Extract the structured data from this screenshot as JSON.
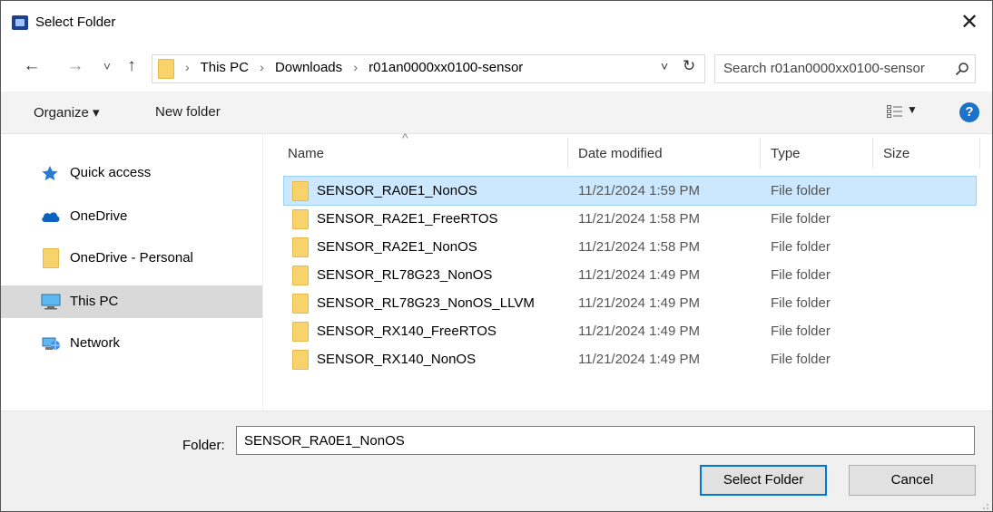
{
  "window": {
    "title": "Select Folder",
    "close_glyph": "✕"
  },
  "nav": {
    "back_glyph": "←",
    "forward_glyph": "→",
    "recent_glyph": "˅",
    "up_glyph": "↑",
    "breadcrumbs": [
      "This PC",
      "Downloads",
      "r01an0000xx0100-sensor"
    ],
    "separator": "›",
    "dropdown_glyph": "˅",
    "refresh_glyph": "↻",
    "search_placeholder": "Search r01an0000xx0100-sensor"
  },
  "toolbar": {
    "organize_label": "Organize ▾",
    "new_folder_label": "New folder",
    "view_dropdown_glyph": "▼",
    "help_glyph": "?"
  },
  "sidebar": {
    "items": [
      {
        "label": "Quick access",
        "icon": "star-icon"
      },
      {
        "label": "OneDrive",
        "icon": "cloud-icon"
      },
      {
        "label": "OneDrive - Personal",
        "icon": "folder-icon"
      },
      {
        "label": "This PC",
        "icon": "computer-icon",
        "selected": true
      },
      {
        "label": "Network",
        "icon": "network-icon"
      }
    ]
  },
  "columns": {
    "name": "Name",
    "date": "Date modified",
    "type": "Type",
    "size": "Size",
    "sort_glyph": "^"
  },
  "files": [
    {
      "name": "SENSOR_RA0E1_NonOS",
      "date": "11/21/2024 1:59 PM",
      "type": "File folder",
      "selected": true
    },
    {
      "name": "SENSOR_RA2E1_FreeRTOS",
      "date": "11/21/2024 1:58 PM",
      "type": "File folder"
    },
    {
      "name": "SENSOR_RA2E1_NonOS",
      "date": "11/21/2024 1:58 PM",
      "type": "File folder"
    },
    {
      "name": "SENSOR_RL78G23_NonOS",
      "date": "11/21/2024 1:49 PM",
      "type": "File folder"
    },
    {
      "name": "SENSOR_RL78G23_NonOS_LLVM",
      "date": "11/21/2024 1:49 PM",
      "type": "File folder"
    },
    {
      "name": "SENSOR_RX140_FreeRTOS",
      "date": "11/21/2024 1:49 PM",
      "type": "File folder"
    },
    {
      "name": "SENSOR_RX140_NonOS",
      "date": "11/21/2024 1:49 PM",
      "type": "File folder"
    }
  ],
  "footer": {
    "folder_label": "Folder:",
    "folder_value": "SENSOR_RA0E1_NonOS",
    "select_label": "Select Folder",
    "cancel_label": "Cancel"
  },
  "colors": {
    "selection_bg": "#cce8ff",
    "accent": "#0078d7",
    "folder": "#f8d26a"
  }
}
